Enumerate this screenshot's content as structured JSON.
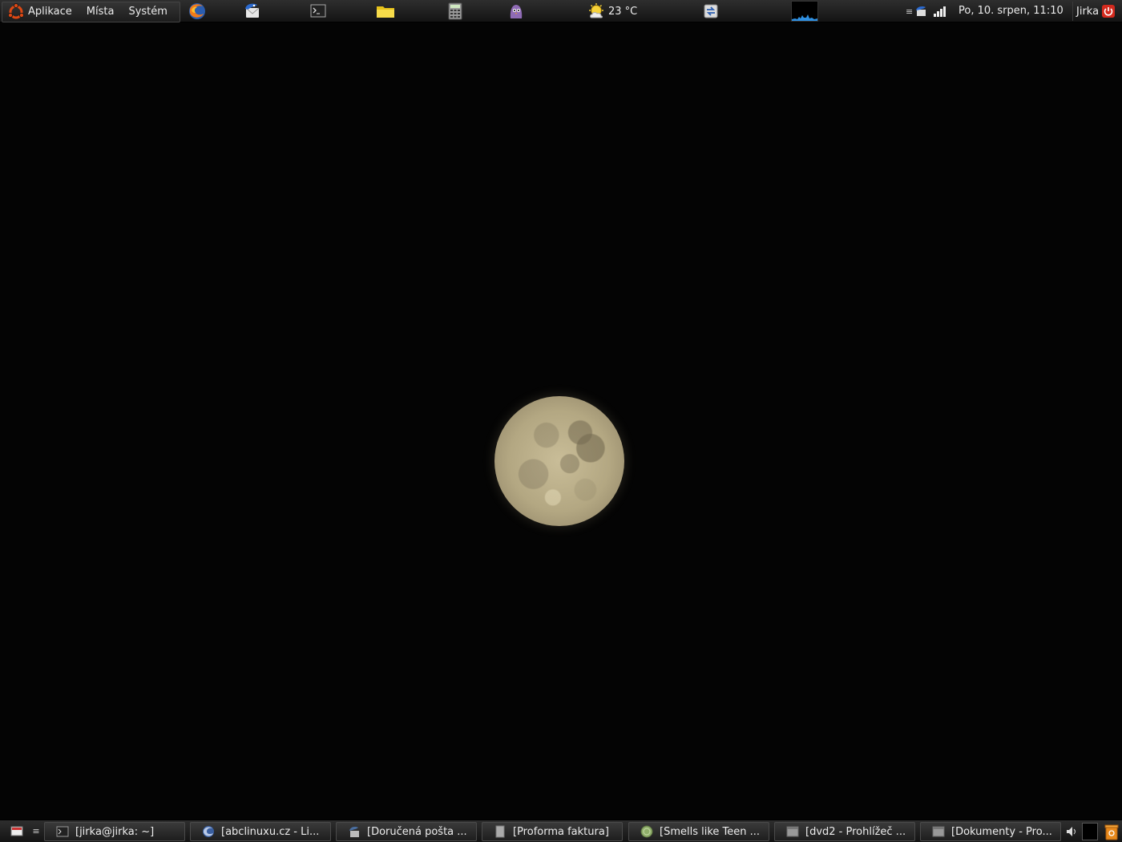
{
  "top_panel": {
    "menus": [
      "Aplikace",
      "Místa",
      "Systém"
    ],
    "launchers": [
      "firefox-icon",
      "thunderbird-icon",
      "terminal-icon",
      "folder-icon",
      "calculator-icon",
      "pidgin-icon"
    ],
    "weather": {
      "temperature": "23 °C",
      "icon": "sun-cloud-icon"
    },
    "clock": "Po, 10. srpen, 11:10",
    "user": "Jirka"
  },
  "taskbar": {
    "tasks": [
      {
        "label": "[jirka@jirka: ~]",
        "icon": "terminal-icon"
      },
      {
        "label": "[abclinuxu.cz - Li...",
        "icon": "firefox-icon"
      },
      {
        "label": "[Doručená pošta ...",
        "icon": "thunderbird-icon"
      },
      {
        "label": "[Proforma faktura]",
        "icon": "document-icon"
      },
      {
        "label": "[Smells like Teen ...",
        "icon": "music-player-icon"
      },
      {
        "label": "[dvd2 - Prohlížeč ...",
        "icon": "file-manager-icon"
      },
      {
        "label": "[Dokumenty - Pro...",
        "icon": "file-manager-icon"
      }
    ]
  },
  "colors": {
    "panel": "#1e1e1e",
    "desktop": "#040404",
    "accent": "#2f8fe0"
  }
}
